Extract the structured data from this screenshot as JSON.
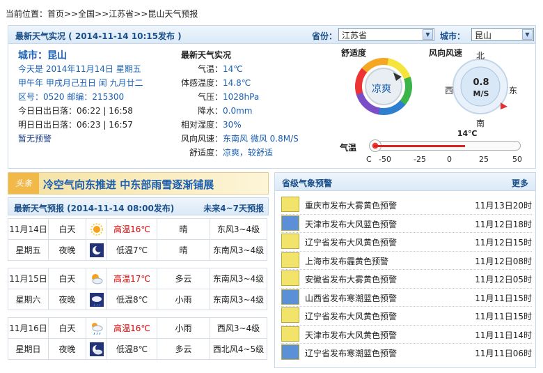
{
  "breadcrumb": {
    "label": "当前位置：",
    "items": [
      "首页",
      ">>全国",
      ">>江苏省",
      ">>昆山天气预报"
    ]
  },
  "live": {
    "title": "最新天气实况 ( 2014-11-14  10:15发布 )",
    "province_label": "省份：",
    "province": "江苏省",
    "city_label": "城市：",
    "city_select": "昆山",
    "city": "城市：昆山",
    "date": "今天是 2014年11月14日 星期五",
    "lunar": "甲午年 甲戌月己丑日 闰 九月廿二",
    "code": "区号：0520   邮编：215300",
    "sun_today": "今日日出日落：06:22 | 16:58",
    "sun_tomorrow": "明日日出日落：06:23 | 16:57",
    "warning": "暂无预警",
    "obs_title": "最新天气实况",
    "obs": [
      {
        "k": "气温：",
        "v": "14℃"
      },
      {
        "k": "体感温度：",
        "v": "14.8℃"
      },
      {
        "k": "气压：",
        "v": "1028hPa"
      },
      {
        "k": "降水：",
        "v": "0.0mm"
      },
      {
        "k": "相对湿度：",
        "v": "30%"
      },
      {
        "k": "风向风速：",
        "v": "东南风 微风 0.8M/S"
      },
      {
        "k": "舒适度：",
        "v": "凉爽，较舒适"
      }
    ],
    "comfort_title": "舒适度",
    "comfort_value": "凉爽",
    "wind_title": "风向风速",
    "wind_speed": "0.8",
    "wind_unit": "M/S",
    "dirs": {
      "n": "北",
      "s": "南",
      "w": "西",
      "e": "东"
    },
    "temp_label": "气温",
    "temp_value": "14℃",
    "temp_number": 14,
    "scale": [
      "C",
      "-50",
      "-25",
      "0",
      "25",
      "50"
    ]
  },
  "headline": {
    "tag": "头条",
    "text": "冷空气向东推进 中东部雨雪逐渐铺展"
  },
  "forecast": {
    "title": "最新天气预报 (2014-11-14 08:00发布)",
    "more": "未来4~7天预报",
    "days": [
      {
        "date": "11月14日",
        "week": "星期五",
        "day": {
          "label": "白天",
          "icon": "sun-icon",
          "temp": "高温16℃",
          "wx": "晴",
          "wind": "东风3~4级"
        },
        "night": {
          "label": "夜晚",
          "icon": "moon-icon",
          "temp": "低温7℃",
          "wx": "晴",
          "wind": "东南风3~4级"
        }
      },
      {
        "date": "11月15日",
        "week": "星期六",
        "day": {
          "label": "白天",
          "icon": "cloudy-sun-icon",
          "temp": "高温17℃",
          "wx": "多云",
          "wind": "东南风3~4级"
        },
        "night": {
          "label": "夜晚",
          "icon": "rain-night-icon",
          "temp": "低温8℃",
          "wx": "小雨",
          "wind": "东南风3~4级"
        }
      },
      {
        "date": "11月16日",
        "week": "星期日",
        "day": {
          "label": "白天",
          "icon": "rain-sun-icon",
          "temp": "高温16℃",
          "wx": "小雨",
          "wind": "西风3~4级"
        },
        "night": {
          "label": "夜晚",
          "icon": "cloudy-night-icon",
          "temp": "低温8℃",
          "wx": "多云",
          "wind": "西北风4~5级"
        }
      }
    ]
  },
  "alerts": {
    "title": "省级气象预警",
    "more": "更多",
    "items": [
      {
        "text": "重庆市发布大雾黄色预警",
        "date": "11月13日20时",
        "icon": "fog-yellow-icon",
        "color": "#f2e46b"
      },
      {
        "text": "天津市发布大风蓝色预警",
        "date": "11月12日18时",
        "icon": "wind-blue-icon",
        "color": "#5b8fd8"
      },
      {
        "text": "辽宁省发布大风黄色预警",
        "date": "11月12日15时",
        "icon": "wind-yellow-icon",
        "color": "#f2e46b"
      },
      {
        "text": "上海市发布霾黄色预警",
        "date": "11月12日08时",
        "icon": "haze-yellow-icon",
        "color": "#f2e46b"
      },
      {
        "text": "安徽省发布大雾黄色预警",
        "date": "11月12日05时",
        "icon": "fog-yellow-icon",
        "color": "#f2e46b"
      },
      {
        "text": "山西省发布寒潮蓝色预警",
        "date": "11月11日15时",
        "icon": "cold-blue-icon",
        "color": "#5b8fd8"
      },
      {
        "text": "辽宁省发布大风黄色预警",
        "date": "11月11日15时",
        "icon": "wind-yellow-icon",
        "color": "#f2e46b"
      },
      {
        "text": "天津市发布大风黄色预警",
        "date": "11月11日14时",
        "icon": "wind-yellow-icon",
        "color": "#f2e46b"
      },
      {
        "text": "辽宁省发布寒潮蓝色预警",
        "date": "11月11日06时",
        "icon": "cold-blue-icon",
        "color": "#5b8fd8"
      }
    ]
  }
}
